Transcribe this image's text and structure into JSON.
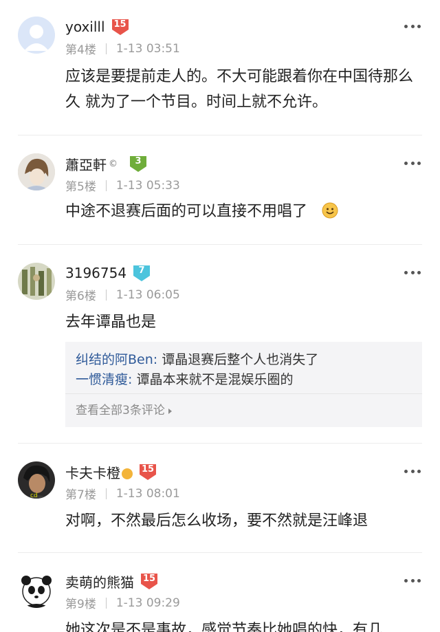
{
  "comments": [
    {
      "username": "yoxilll",
      "level": "15",
      "floor": "第4楼",
      "time": "1-13 03:51",
      "text": "应该是要提前走人的。不大可能跟着你在中国待那么久 就为了一个节目。时间上就不允许。"
    },
    {
      "username": "蕭亞軒",
      "name_suffix": "©",
      "level": "3",
      "floor": "第5楼",
      "time": "1-13 05:33",
      "text": "中途不退赛后面的可以直接不用唱了"
    },
    {
      "username": "3196754",
      "level": "7",
      "floor": "第6楼",
      "time": "1-13 06:05",
      "text": "去年谭晶也是",
      "replies": [
        {
          "author": "纠结的阿Ben:",
          "text": " 谭晶退赛后整个人也消失了"
        },
        {
          "author": "一惯清瘦:",
          "text": " 谭晶本来就不是混娱乐圈的"
        }
      ],
      "replies_more": "查看全部3条评论"
    },
    {
      "username": "卡夫卡橙",
      "level": "15",
      "floor": "第7楼",
      "time": "1-13 08:01",
      "text": "对啊，不然最后怎么收场，要不然就是汪峰退"
    },
    {
      "username": "卖萌的熊猫",
      "level": "15",
      "floor": "第9楼",
      "time": "1-13 09:29",
      "text": "她这次是不是事故，感觉节奏比她唱的快，有几"
    }
  ],
  "colors": {
    "badge_red": "#e8544a",
    "badge_green": "#6fad3a",
    "badge_cyan": "#4cc4dd",
    "reply_author": "#2f5a99"
  }
}
